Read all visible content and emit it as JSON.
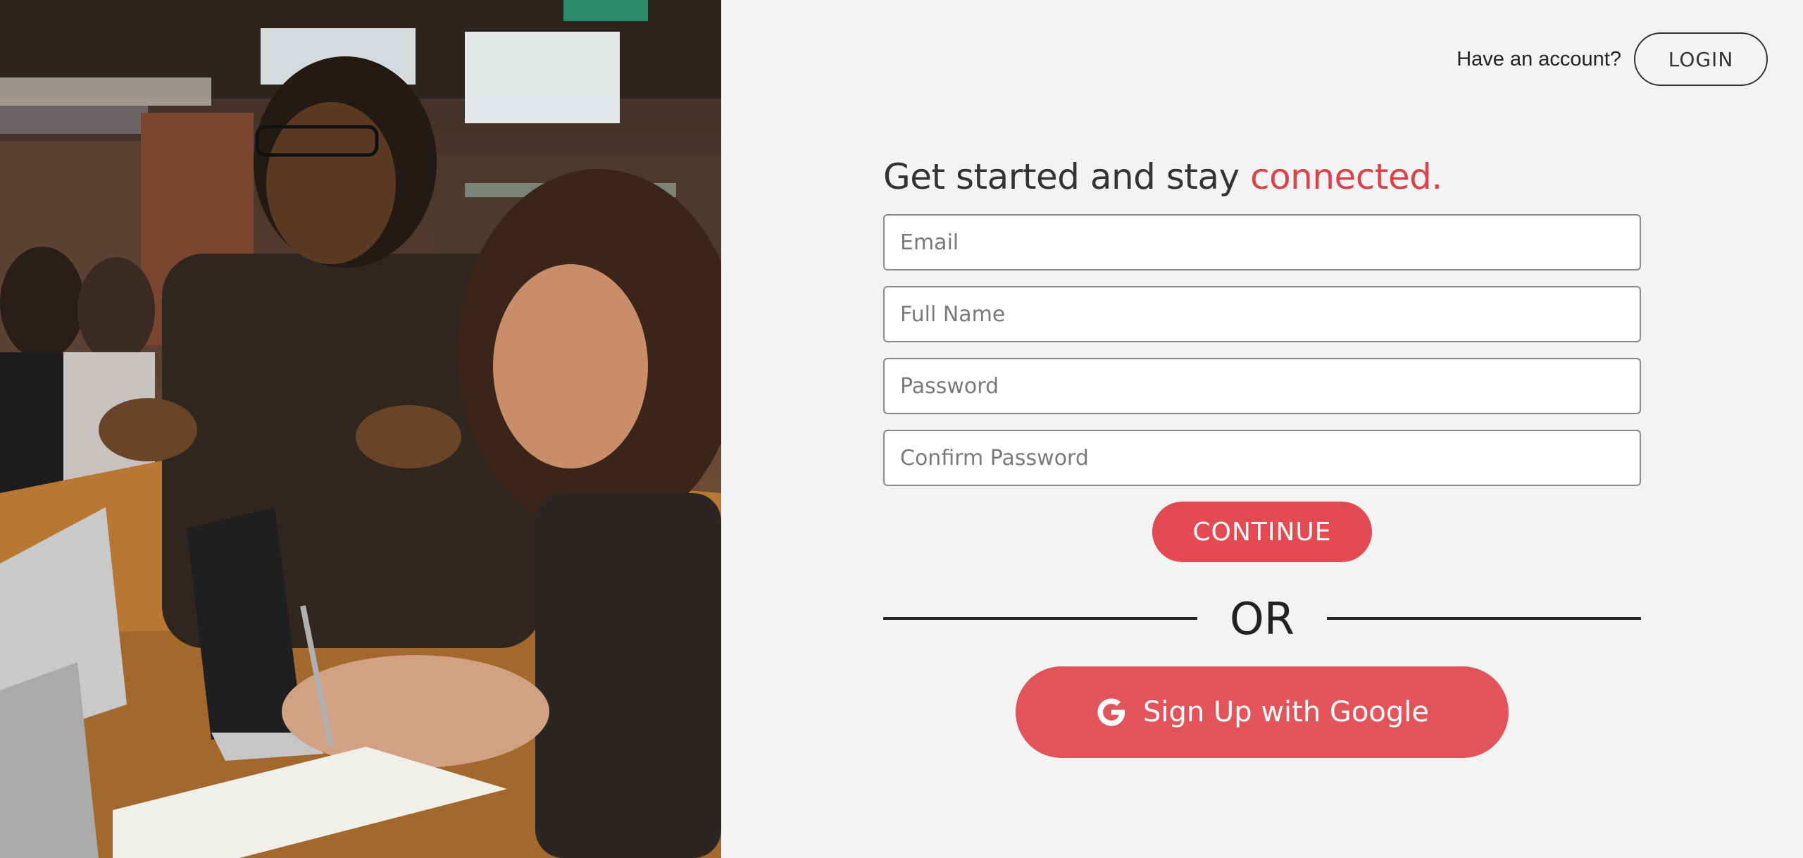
{
  "header": {
    "account_prompt": "Have an account?",
    "login_label": "LOGIN"
  },
  "form": {
    "headline_main": "Get started and stay ",
    "headline_accent": "connected.",
    "email_placeholder": "Email",
    "fullname_placeholder": "Full Name",
    "password_placeholder": "Password",
    "confirm_password_placeholder": "Confirm Password",
    "continue_label": "CONTINUE",
    "or_label": "OR",
    "google_label": "Sign Up with Google",
    "google_icon": "google-g-icon"
  },
  "colors": {
    "accent": "#d8434c",
    "button": "#e34b53",
    "google_button": "#e2545a",
    "background": "#f3f3f3"
  }
}
